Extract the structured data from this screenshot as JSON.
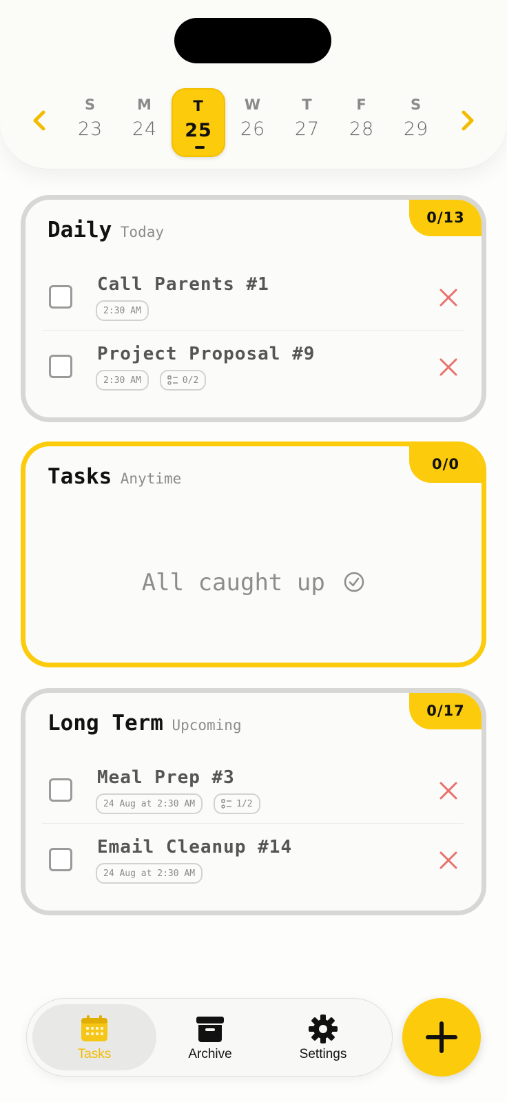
{
  "colors": {
    "accent": "#fccb0c",
    "delete": "#e8716b",
    "muted": "#8a8a8a"
  },
  "calendar": {
    "prev_icon": "chevron-left-icon",
    "next_icon": "chevron-right-icon",
    "days": [
      {
        "dow": "S",
        "num": "23"
      },
      {
        "dow": "M",
        "num": "24"
      },
      {
        "dow": "T",
        "num": "25",
        "selected": true
      },
      {
        "dow": "W",
        "num": "26"
      },
      {
        "dow": "T",
        "num": "27"
      },
      {
        "dow": "F",
        "num": "28"
      },
      {
        "dow": "S",
        "num": "29"
      }
    ]
  },
  "daily": {
    "title": "Daily",
    "subtitle": "Today",
    "count": "0/13",
    "tasks": [
      {
        "title": "Call Parents #1",
        "time": "2:30 AM"
      },
      {
        "title": "Project Proposal #9",
        "time": "2:30 AM",
        "subtasks": "0/2"
      }
    ]
  },
  "anytime": {
    "title": "Tasks",
    "subtitle": "Anytime",
    "count": "0/0",
    "empty_text": "All caught up"
  },
  "longterm": {
    "title": "Long Term",
    "subtitle": "Upcoming",
    "count": "0/17",
    "tasks": [
      {
        "title": "Meal Prep #3",
        "time": "24 Aug at 2:30 AM",
        "subtasks": "1/2"
      },
      {
        "title": "Email Cleanup #14",
        "time": "24 Aug at 2:30 AM"
      }
    ]
  },
  "tabs": [
    {
      "label": "Tasks",
      "icon": "calendar-icon",
      "active": true
    },
    {
      "label": "Archive",
      "icon": "archive-box-icon"
    },
    {
      "label": "Settings",
      "icon": "gear-icon"
    }
  ],
  "fab_icon": "plus-icon"
}
